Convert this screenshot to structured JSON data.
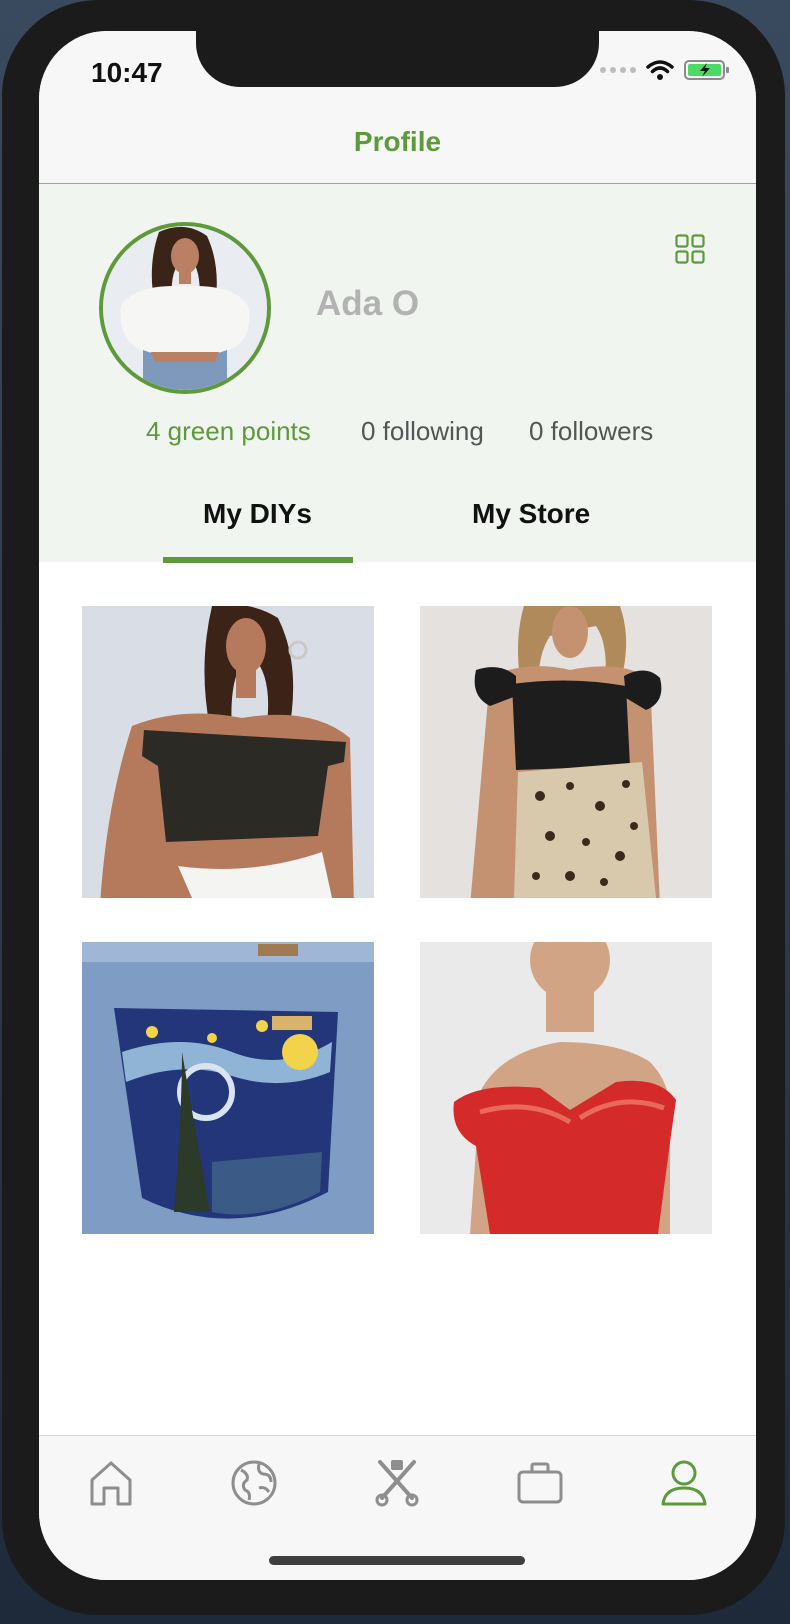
{
  "status_bar": {
    "time": "10:47"
  },
  "header": {
    "title": "Profile"
  },
  "profile": {
    "name": "Ada O",
    "stats": {
      "green_points": "4 green points",
      "following": "0 following",
      "followers": "0 followers"
    }
  },
  "tabs": [
    {
      "label": "My DIYs",
      "active": true
    },
    {
      "label": "My Store",
      "active": false
    }
  ],
  "gallery": [
    {
      "name": "off-shoulder-black-top"
    },
    {
      "name": "black-top-leopard-skirt"
    },
    {
      "name": "starry-night-jeans-pocket"
    },
    {
      "name": "red-satin-off-shoulder-top"
    }
  ],
  "tab_bar": {
    "items": [
      "home-icon",
      "globe-icon",
      "scissors-icon",
      "briefcase-icon",
      "person-icon"
    ],
    "active": "person-icon"
  },
  "colors": {
    "accent": "#5e9a3b",
    "panel": "#f0f5f0"
  }
}
